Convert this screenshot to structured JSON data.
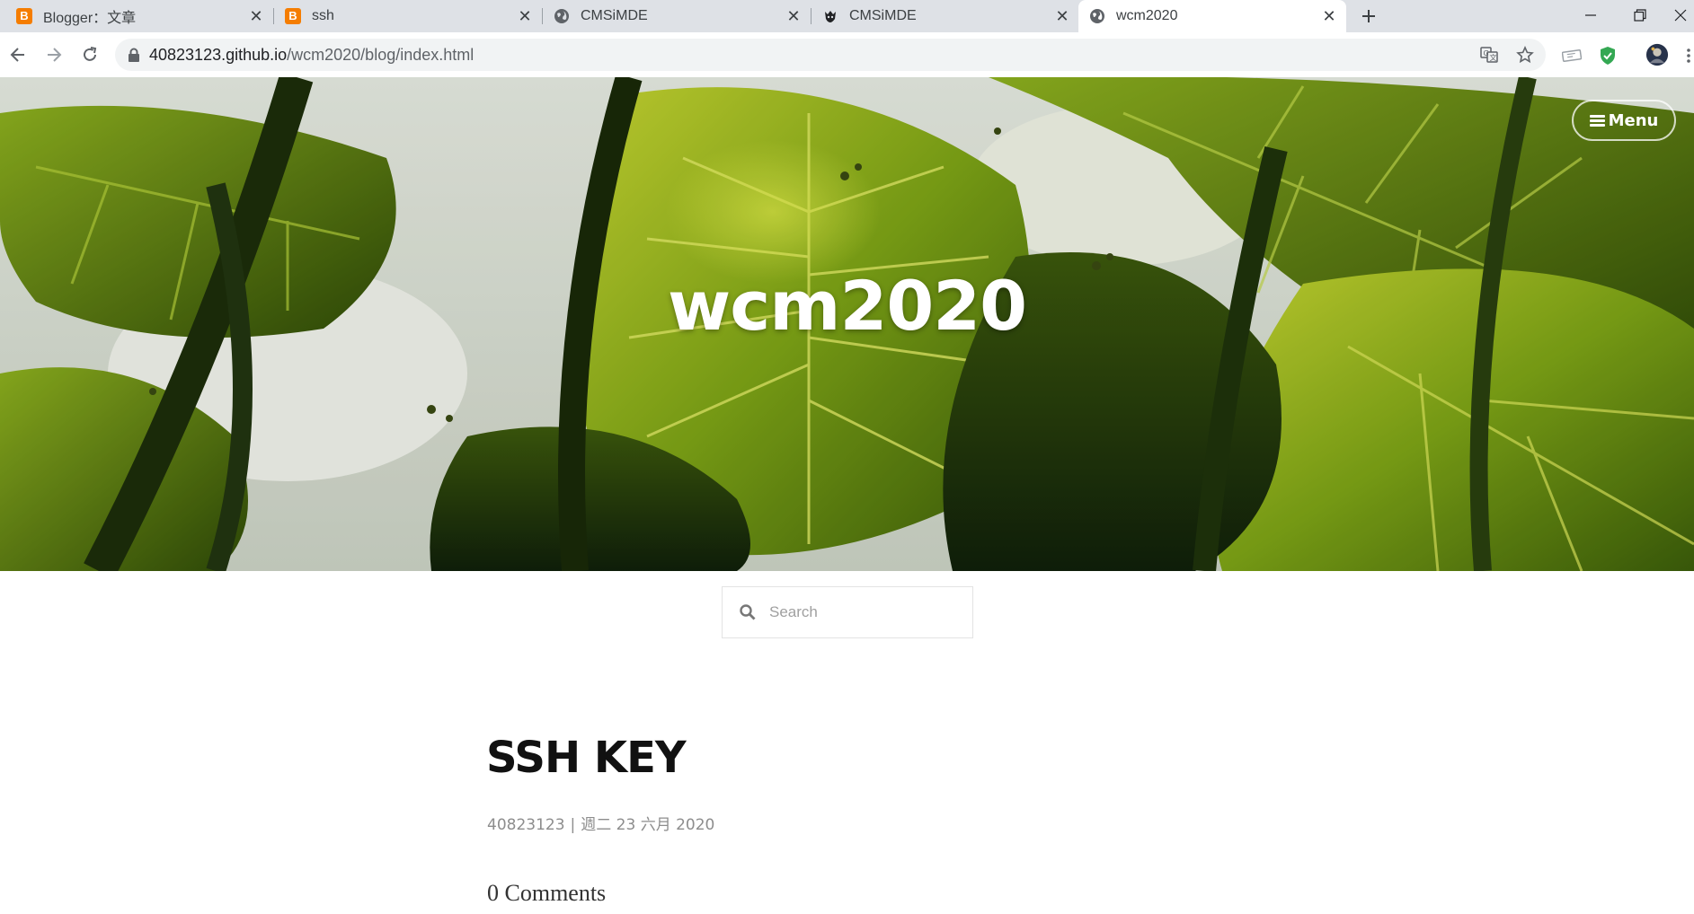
{
  "browser": {
    "tabs": [
      {
        "title": "Blogger：文章",
        "favicon": "blogger-icon",
        "active": false
      },
      {
        "title": "ssh",
        "favicon": "blogger-icon",
        "active": false
      },
      {
        "title": "CMSiMDE",
        "favicon": "globe-icon",
        "active": false
      },
      {
        "title": "CMSiMDE",
        "favicon": "github-octocat-icon",
        "active": false
      },
      {
        "title": "wcm2020",
        "favicon": "globe-icon",
        "active": true
      }
    ],
    "url_host": "40823123.github.io",
    "url_path": "/wcm2020/blog/index.html",
    "colors": {
      "tabstrip": "#dee1e6",
      "omnibox": "#f1f3f4",
      "shield_extension": "#34a853"
    }
  },
  "page": {
    "site_title": "wcm2020",
    "menu_label": "Menu",
    "search_placeholder": "Search",
    "post": {
      "title": "SSH KEY",
      "author": "40823123",
      "separator": "|",
      "date": "週二 23 六月 2020",
      "comments": "0 Comments"
    }
  }
}
